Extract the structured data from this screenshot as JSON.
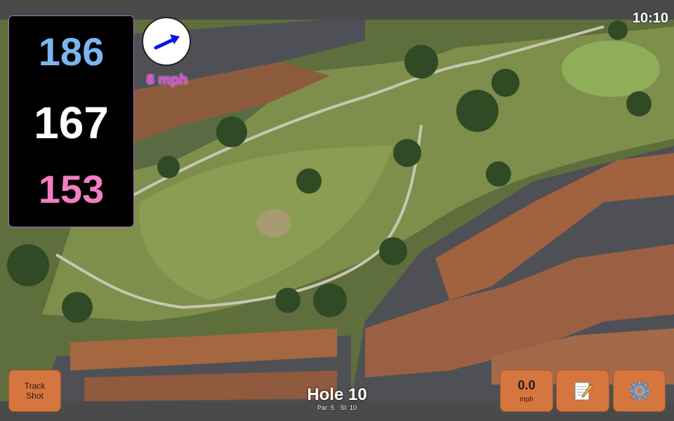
{
  "clock": "10:10",
  "distances": {
    "back": "186",
    "middle": "167",
    "front": "153"
  },
  "wind": {
    "speed_label": "8 mph",
    "direction_icon": "wind-arrow-icon"
  },
  "hole": {
    "title": "Hole 10",
    "par": "Par: 5",
    "si": "SI: 10"
  },
  "buttons": {
    "track_line1": "Track",
    "track_line2": "Shot",
    "speed_value": "0.0",
    "speed_unit": "mph",
    "notes_icon": "notepad-icon",
    "settings_icon": "gear-icon"
  },
  "colors": {
    "back": "#7ab6f0",
    "middle": "#ffffff",
    "front": "#f27ec1",
    "wind_label": "#e23be0",
    "button": "#d6763f"
  }
}
